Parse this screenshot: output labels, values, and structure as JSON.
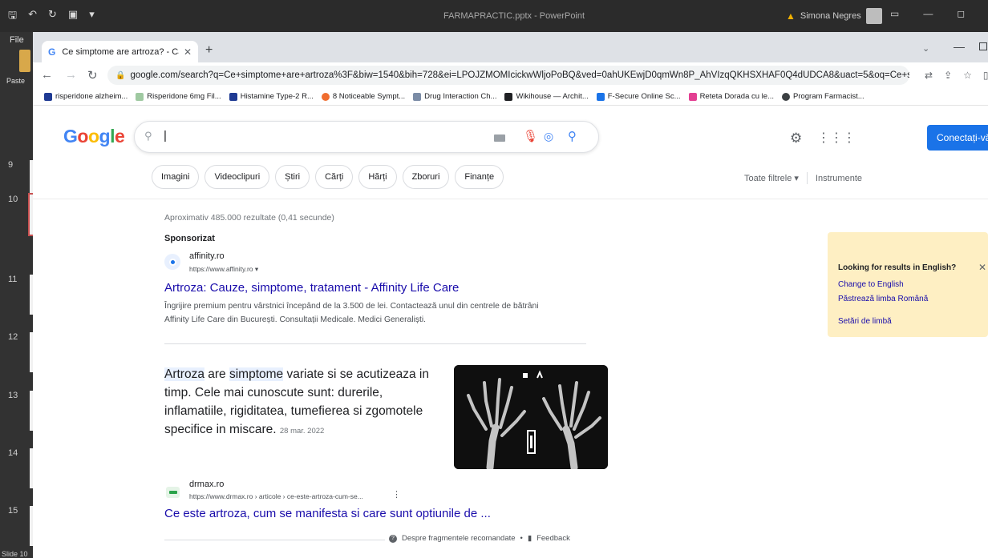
{
  "powerpoint": {
    "title": "FARMAPRACTIC.pptx  -  PowerPoint",
    "user_name": "Simona Negres",
    "file_tab": "File",
    "paste_label": "Paste",
    "slide_numbers": [
      "9",
      "10",
      "11",
      "12",
      "13",
      "14",
      "15"
    ],
    "status_text": "Slide 10"
  },
  "browser": {
    "tab_title": "Ce simptome are artroza? - Căutare Google",
    "url": "google.com/search?q=Ce+simptome+are+artroza%3F&biw=1540&bih=728&ei=LPOJZMOMIcickwWljoPoBQ&ved=0ahUKEwjD0qmWn8P_AhVIzqQKHSXHAF0Q4dUDCA8&uact=5&oq=Ce+s...",
    "bookmarks": [
      {
        "label": "risperidone alzheim...",
        "color": "#1f3a93"
      },
      {
        "label": "Risperidone 6mg Fil...",
        "color": "#9fc9a1"
      },
      {
        "label": "Histamine Type-2 R...",
        "color": "#1f3a93"
      },
      {
        "label": "8 Noticeable Sympt...",
        "color": "#f06d2f"
      },
      {
        "label": "Drug Interaction Ch...",
        "color": "#7b8ca6"
      },
      {
        "label": "Wikihouse — Archit...",
        "color": "#202124"
      },
      {
        "label": "F-Secure Online Sc...",
        "color": "#1a73e8"
      },
      {
        "label": "Reteta Dorada cu le...",
        "color": "#e33f92"
      },
      {
        "label": "Program Farmacist...",
        "color": "#3c4043"
      }
    ]
  },
  "google": {
    "logo": "Google",
    "signin": "Conectați-vă",
    "chips": [
      "Imagini",
      "Videoclipuri",
      "Știri",
      "Cărți",
      "Hărți",
      "Zboruri",
      "Finanțe"
    ],
    "all_filters": "Toate filtrele",
    "tools": "Instrumente",
    "stats": "Aproximativ 485.000 rezultate (0,41 secunde)",
    "ad": {
      "label": "Sponsorizat",
      "site": "affinity.ro",
      "url": "https://www.affinity.ro",
      "title": "Artroza: Cauze, simptome, tratament - Affinity Life Care",
      "description": "Îngrijire premium pentru vârstnici începând de la 3.500 de lei. Contactează unul din centrele de bătrâni Affinity Life Care din București. Consultații Medicale. Medici Generaliști."
    },
    "snippet": {
      "hl1": "Artroza",
      "t1": " are ",
      "hl2": "simptome",
      "t2": " variate si se acutizeaza in timp. Cele mai cunoscute sunt: durerile, inflamatiile, rigiditatea, tumefierea si zgomotele specifice in miscare.",
      "date": "28 mar. 2022"
    },
    "result": {
      "site": "drmax.ro",
      "url": "https://www.drmax.ro › articole › ce-este-artroza-cum-se...",
      "title": "Ce este artroza, cum se manifesta si care sunt optiunile de ..."
    },
    "featured_footer": {
      "about": "Despre fragmentele recomandate",
      "feedback": "Feedback"
    },
    "language_box": {
      "question": "Looking for results in English?",
      "change": "Change to English",
      "keep": "Păstrează limba Română",
      "settings": "Setări de limbă"
    }
  }
}
